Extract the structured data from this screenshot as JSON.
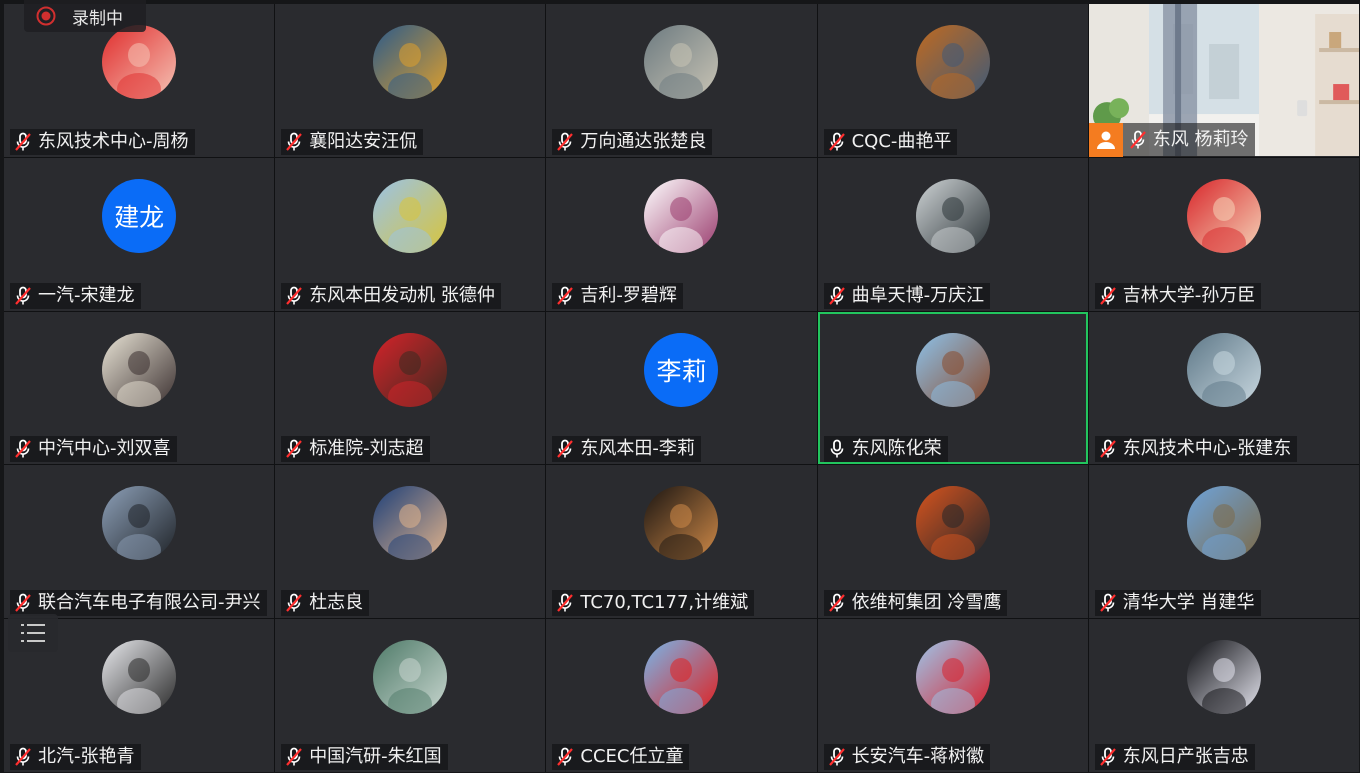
{
  "recording": {
    "label": "录制中",
    "color": "#d12f2f"
  },
  "list_toggle": {
    "icon": "list-icon"
  },
  "participants": [
    {
      "name": "东风技术中心-周杨",
      "avatar": {
        "kind": "img",
        "c1": "#e02c2c",
        "c2": "#f5c3b5"
      }
    },
    {
      "name": "襄阳达安汪侃",
      "avatar": {
        "kind": "img",
        "c1": "#2b5a8a",
        "c2": "#e0a02c"
      }
    },
    {
      "name": "万向通达张楚良",
      "avatar": {
        "kind": "img",
        "c1": "#6c7a80",
        "c2": "#c9c4b5"
      }
    },
    {
      "name": "CQC-曲艳平",
      "avatar": {
        "kind": "img",
        "c1": "#c06a20",
        "c2": "#3f5a78"
      }
    },
    {
      "name": "东风 杨莉玲",
      "photo": true
    },
    {
      "name": "一汽-宋建龙",
      "avatar": {
        "kind": "text",
        "text": "建龙"
      }
    },
    {
      "name": "东风本田发动机 张德仲",
      "avatar": {
        "kind": "img",
        "c1": "#9ac3e8",
        "c2": "#d8c43a"
      }
    },
    {
      "name": "吉利-罗碧辉",
      "avatar": {
        "kind": "img",
        "c1": "#ffffff",
        "c2": "#9a3c6e"
      }
    },
    {
      "name": "曲阜天博-万庆江",
      "avatar": {
        "kind": "img",
        "c1": "#cfd4d6",
        "c2": "#2c3438"
      }
    },
    {
      "name": "吉林大学-孙万臣",
      "avatar": {
        "kind": "img",
        "c1": "#d8262a",
        "c2": "#f5d3b8"
      }
    },
    {
      "name": "中汽中心-刘双喜",
      "avatar": {
        "kind": "img",
        "c1": "#e9e4d6",
        "c2": "#3b3030"
      }
    },
    {
      "name": "标准院-刘志超",
      "avatar": {
        "kind": "img",
        "c1": "#d6232a",
        "c2": "#3a2a20"
      }
    },
    {
      "name": "东风本田-李莉",
      "avatar": {
        "kind": "text",
        "text": "李莉"
      }
    },
    {
      "name": "东风陈化荣",
      "active": true,
      "mic_on": true,
      "avatar": {
        "kind": "img",
        "c1": "#8cc2ea",
        "c2": "#8a4a2c"
      }
    },
    {
      "name": "东风技术中心-张建东",
      "avatar": {
        "kind": "img",
        "c1": "#5e7888",
        "c2": "#c9d8e0"
      }
    },
    {
      "name": "联合汽车电子有限公司-尹兴",
      "avatar": {
        "kind": "img",
        "c1": "#8da0b8",
        "c2": "#1f2328"
      }
    },
    {
      "name": "杜志良",
      "avatar": {
        "kind": "img",
        "c1": "#1d3f78",
        "c2": "#e2b48c"
      }
    },
    {
      "name": "TC70,TC177,计维斌",
      "avatar": {
        "kind": "img",
        "c1": "#1a1512",
        "c2": "#d08a48"
      }
    },
    {
      "name": "依维柯集团 冷雪鹰",
      "avatar": {
        "kind": "img",
        "c1": "#d8541e",
        "c2": "#23262a"
      }
    },
    {
      "name": "清华大学 肖建华",
      "avatar": {
        "kind": "img",
        "c1": "#6ea4dc",
        "c2": "#7c6a48"
      }
    },
    {
      "name": "北汽-张艳青",
      "avatar": {
        "kind": "img",
        "c1": "#e9eaee",
        "c2": "#2a2a2a"
      }
    },
    {
      "name": "中国汽研-朱红国",
      "avatar": {
        "kind": "img",
        "c1": "#4e7a68",
        "c2": "#c8d6cf"
      }
    },
    {
      "name": "CCEC任立童",
      "avatar": {
        "kind": "img",
        "c1": "#77b6ea",
        "c2": "#e02020"
      }
    },
    {
      "name": "长安汽车-蒋树徽",
      "avatar": {
        "kind": "img",
        "c1": "#9cc6ea",
        "c2": "#d8202c"
      }
    },
    {
      "name": "东风日产张吉忠",
      "avatar": {
        "kind": "img",
        "c1": "#0b0c10",
        "c2": "#e6e6f0"
      }
    }
  ]
}
